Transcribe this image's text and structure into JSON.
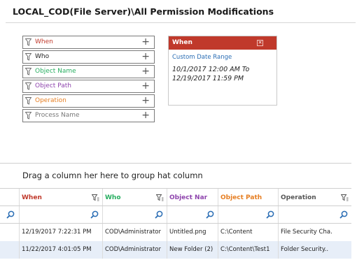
{
  "page": {
    "title": "LOCAL_COD(File Server)\\All Permission Modifications"
  },
  "filters": [
    {
      "label": "When",
      "color": "#c0392b"
    },
    {
      "label": "Who",
      "color": "#222222"
    },
    {
      "label": "Object Name",
      "color": "#27ae60"
    },
    {
      "label": "Object Path",
      "color": "#8e44ad"
    },
    {
      "label": "Operation",
      "color": "#e67e22"
    },
    {
      "label": "Process Name",
      "color": "#777777"
    }
  ],
  "when_panel": {
    "title": "When",
    "close_icon": "close-icon",
    "link": "Custom Date Range",
    "range_line1": "10/1/2017 12:00 AM To",
    "range_line2": "12/19/2017 11:59 PM",
    "header_color": "#c0392b"
  },
  "grid": {
    "group_hint": "Drag a column her here to group hat column",
    "columns": [
      {
        "label": "When",
        "color": "#c0392b"
      },
      {
        "label": "Who",
        "color": "#27ae60"
      },
      {
        "label": "Object Nar",
        "color": "#8e44ad"
      },
      {
        "label": "Object Path",
        "color": "#e67e22"
      },
      {
        "label": "Operation",
        "color": "#555555"
      }
    ],
    "rows": [
      [
        "12/19/2017 7:22:31 PM",
        "COD\\Administrator",
        "Untitled.png",
        "C:\\Content",
        "File Security Cha."
      ],
      [
        "11/22/2017 4:01:05 PM",
        "COD\\Administrator",
        "New Folder (2)",
        "C:\\Content\\Test1",
        "Folder Security.."
      ]
    ],
    "selected_row_color": "#e7eef8"
  },
  "icons": {
    "filter": "funnel-icon",
    "add": "plus-icon",
    "search": "search-icon"
  }
}
